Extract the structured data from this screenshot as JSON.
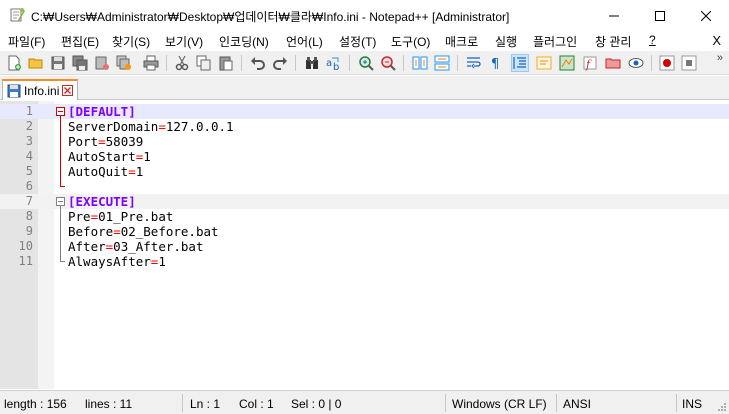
{
  "window": {
    "title": "C:₩Users₩Administrator₩Desktop₩업데이터₩클라₩Info.ini - Notepad++ [Administrator]"
  },
  "menu": {
    "items": [
      "파일(F)",
      "편집(E)",
      "찾기(S)",
      "보기(V)",
      "인코딩(N)",
      "언어(L)",
      "설정(T)",
      "도구(O)",
      "매크로",
      "실행",
      "플러그인",
      "창 관리",
      "?"
    ],
    "close": "X"
  },
  "toolbar": {
    "more": "»",
    "buttons": [
      "new-file",
      "open-file",
      "save",
      "save-all",
      "close",
      "close-all",
      "print",
      "cut",
      "copy",
      "paste",
      "undo",
      "redo",
      "find",
      "replace",
      "zoom-in",
      "zoom-out",
      "sync-vertical",
      "sync-horizontal",
      "word-wrap",
      "show-all-chars",
      "indent-guide",
      "user-defined-language",
      "document-map",
      "function-list",
      "folder-as-workspace",
      "monitoring",
      "record-macro",
      "stop-record"
    ]
  },
  "tabs": [
    {
      "label": "Info.ini",
      "active": true
    }
  ],
  "editor": {
    "lines": [
      {
        "n": "1",
        "type": "section",
        "text": "[DEFAULT]"
      },
      {
        "n": "2",
        "type": "kv",
        "key": "ServerDomain",
        "value": "127.0.0.1"
      },
      {
        "n": "3",
        "type": "kv",
        "key": "Port",
        "value": "58039"
      },
      {
        "n": "4",
        "type": "kv",
        "key": "AutoStart",
        "value": "1"
      },
      {
        "n": "5",
        "type": "kv",
        "key": "AutoQuit",
        "value": "1"
      },
      {
        "n": "6",
        "type": "blank",
        "text": ""
      },
      {
        "n": "7",
        "type": "section",
        "text": "[EXECUTE]"
      },
      {
        "n": "8",
        "type": "kv",
        "key": "Pre",
        "value": "01_Pre.bat"
      },
      {
        "n": "9",
        "type": "kv",
        "key": "Before",
        "value": "02_Before.bat"
      },
      {
        "n": "10",
        "type": "kv",
        "key": "After",
        "value": "03_After.bat"
      },
      {
        "n": "11",
        "type": "kv",
        "key": "AlwaysAfter",
        "value": "1"
      }
    ],
    "equals": "="
  },
  "status": {
    "length": "length : 156",
    "lines": "lines : 11",
    "ln": "Ln : 1",
    "col": "Col : 1",
    "sel": "Sel : 0 | 0",
    "eol": "Windows (CR LF)",
    "encoding": "ANSI",
    "mode": "INS"
  },
  "colors": {
    "section": "#8000ff",
    "equals": "#ff0000",
    "tab_accent": "#fa8c28",
    "current_line": "#e8e8ff"
  }
}
